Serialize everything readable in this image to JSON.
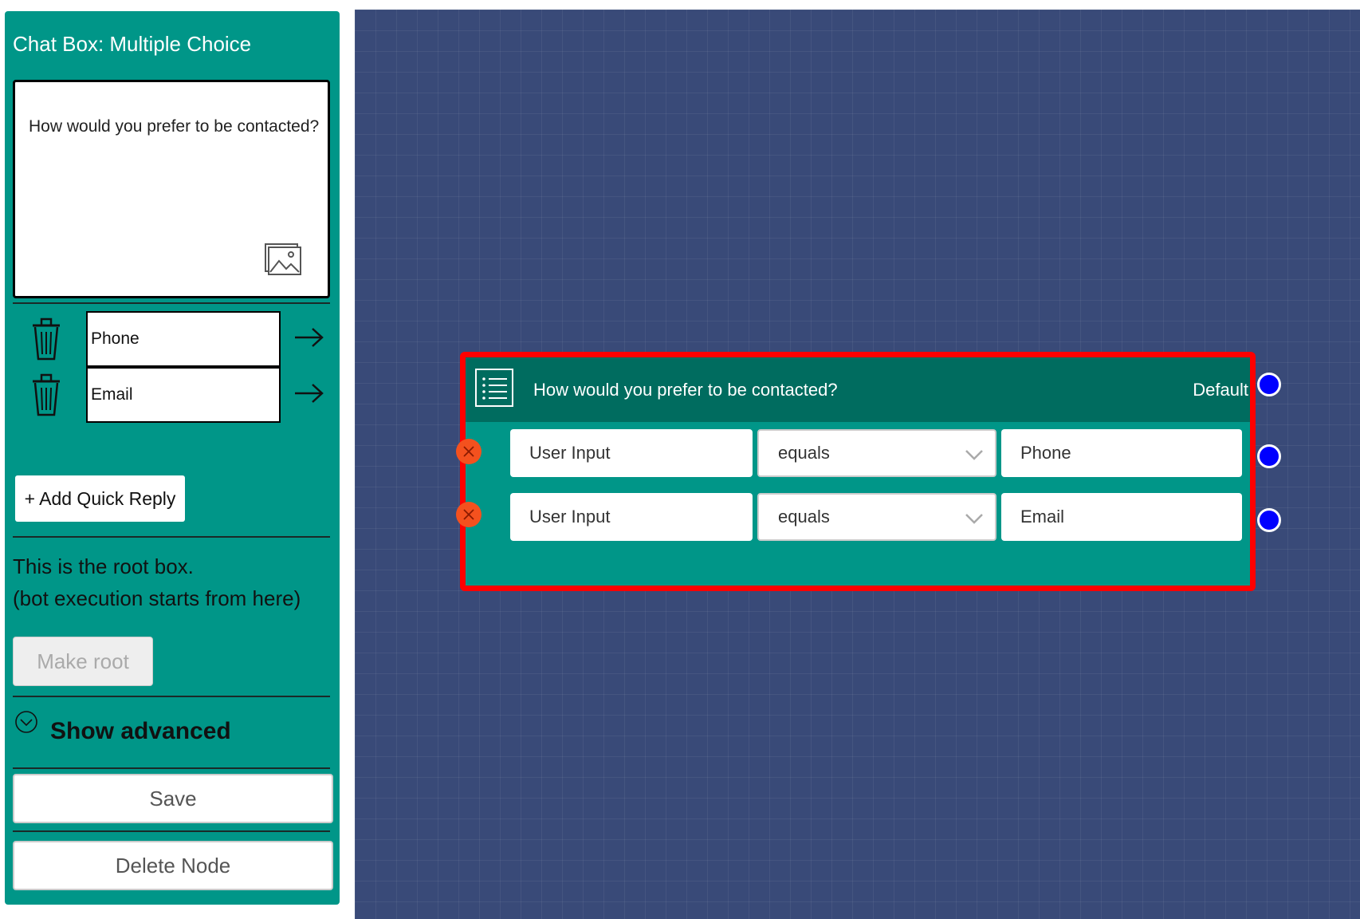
{
  "panel": {
    "title": "Chat Box: Multiple Choice",
    "message": "How would you prefer to be contacted?",
    "quick_replies": [
      {
        "label": "Phone"
      },
      {
        "label": "Email"
      }
    ],
    "add_quick_reply_label": "+ Add Quick Reply",
    "root_line1": "This is the root box.",
    "root_line2": "(bot execution starts from here)",
    "make_root_label": "Make root",
    "show_advanced_label": "Show advanced",
    "save_label": "Save",
    "delete_label": "Delete Node"
  },
  "node": {
    "title": "How would you prefer to be contacted?",
    "default_label": "Default",
    "conditions": [
      {
        "field": "User Input",
        "operator": "equals",
        "value": "Phone"
      },
      {
        "field": "User Input",
        "operator": "equals",
        "value": "Email"
      }
    ]
  },
  "colors": {
    "panel_bg": "#009688",
    "node_header": "#006c5f",
    "canvas_bg": "#394a78",
    "selection_border": "#ff0000",
    "port": "#0000ff",
    "delete_condition": "#f4511e"
  },
  "icons": [
    "image-icon",
    "trash-icon",
    "arrow-right-icon",
    "chevron-circle-down-icon",
    "list-icon",
    "remove-condition-icon",
    "chevron-down-icon"
  ]
}
